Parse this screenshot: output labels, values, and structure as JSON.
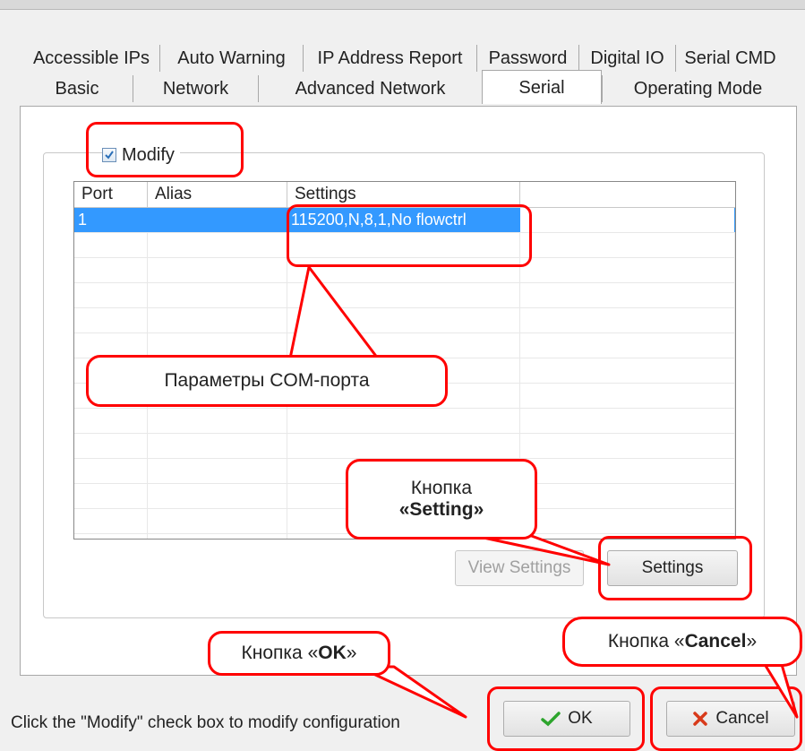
{
  "tabs_top": [
    "Accessible IPs",
    "Auto Warning",
    "IP Address Report",
    "Password",
    "Digital IO",
    "Serial CMD"
  ],
  "tabs_bottom": [
    "Basic",
    "Network",
    "Advanced Network",
    "Serial",
    "Operating Mode"
  ],
  "active_tab": "Serial",
  "modify": {
    "label": "Modify",
    "checked": true
  },
  "table": {
    "columns": [
      "Port",
      "Alias",
      "Settings"
    ],
    "rows": [
      {
        "port": "1",
        "alias": "",
        "settings": "115200,N,8,1,No flowctrl",
        "selected": true
      }
    ]
  },
  "buttons": {
    "view_settings": "View Settings",
    "settings": "Settings",
    "ok": "OK",
    "cancel": "Cancel"
  },
  "status_text": "Click the \"Modify\" check box to modify configuration",
  "annotations": {
    "com_params": "Параметры COM-порта",
    "setting_btn_line1": "Кнопка",
    "setting_btn_line2_prefix": "«",
    "setting_btn_name": "Setting",
    "setting_btn_line2_suffix": "»",
    "ok_prefix": "Кнопка «",
    "ok_name": "OK",
    "ok_suffix": "»",
    "cancel_prefix": "Кнопка «",
    "cancel_name": "Cancel",
    "cancel_suffix": "»"
  },
  "colors": {
    "highlight": "#ff0000",
    "selection": "#3399ff",
    "check": "#2a6fb8"
  }
}
